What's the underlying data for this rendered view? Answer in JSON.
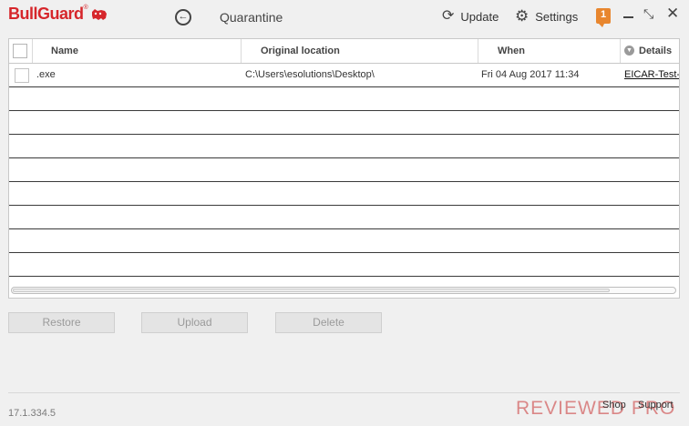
{
  "header": {
    "logo_text": "BullGuard",
    "logo_reg": "®",
    "title": "Quarantine",
    "update_label": "Update",
    "settings_label": "Settings",
    "notification_count": "1",
    "icons": {
      "back": "back-arrow-icon",
      "update": "refresh-icon",
      "settings": "gear-icon",
      "minimize": "minimize-icon",
      "restore": "restore-window-icon",
      "close": "close-icon"
    }
  },
  "table": {
    "columns": [
      "Name",
      "Original location",
      "When",
      "Details"
    ],
    "rows": [
      {
        "name": ".exe",
        "location": "C:\\Users\\esolutions\\Desktop\\",
        "when": "Fri 04 Aug 2017 11:34",
        "details": "EICAR-Test-"
      }
    ]
  },
  "actions": {
    "restore": "Restore",
    "upload": "Upload",
    "delete": "Delete"
  },
  "footer": {
    "version": "17.1.334.5",
    "shop": "Shop",
    "support": "Support",
    "watermark": "REVIEWED PRO"
  },
  "colors": {
    "brand": "#d6262b",
    "notification": "#e8862e"
  }
}
